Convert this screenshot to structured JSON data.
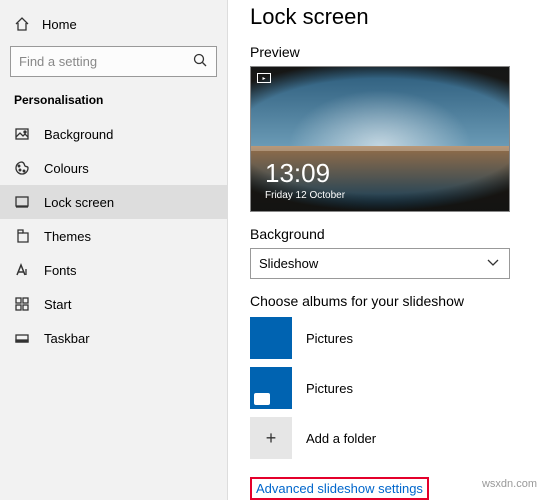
{
  "sidebar": {
    "home": "Home",
    "search_placeholder": "Find a setting",
    "category": "Personalisation",
    "items": [
      {
        "label": "Background",
        "icon": "image-icon"
      },
      {
        "label": "Colours",
        "icon": "palette-icon"
      },
      {
        "label": "Lock screen",
        "icon": "lock-screen-icon",
        "selected": true
      },
      {
        "label": "Themes",
        "icon": "themes-icon"
      },
      {
        "label": "Fonts",
        "icon": "fonts-icon"
      },
      {
        "label": "Start",
        "icon": "start-icon"
      },
      {
        "label": "Taskbar",
        "icon": "taskbar-icon"
      }
    ]
  },
  "main": {
    "title": "Lock screen",
    "preview_label": "Preview",
    "preview": {
      "time": "13:09",
      "date": "Friday 12 October"
    },
    "background_label": "Background",
    "background_value": "Slideshow",
    "albums_label": "Choose albums for your slideshow",
    "albums": [
      {
        "label": "Pictures",
        "tile": "blue"
      },
      {
        "label": "Pictures",
        "tile": "acc"
      }
    ],
    "add_folder": "Add a folder",
    "advanced_link": "Advanced slideshow settings"
  },
  "watermark": "wsxdn.com"
}
